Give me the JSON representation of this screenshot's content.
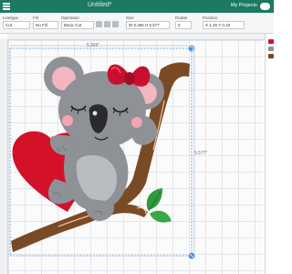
{
  "app": {
    "title": "Untitled*",
    "my_projects": "My Projects"
  },
  "toolbar": {
    "groups": [
      {
        "label": "Linetype",
        "value": "Cut"
      },
      {
        "label": "Fill",
        "value": "No Fill"
      },
      {
        "label": "Operation",
        "value": "Basic Cut"
      },
      {
        "label": "Size",
        "value": "W 5.366  H 5.577"
      },
      {
        "label": "Rotate",
        "value": "0"
      },
      {
        "label": "Position",
        "value": "X 1.45  Y 0.18"
      }
    ]
  },
  "canvas": {
    "width_dimension": "5.366\"",
    "height_dimension": "5.577\""
  },
  "colors": {
    "topbar": "#1c7a64",
    "koala_gray": "#8e9196",
    "heart_red": "#d3122a",
    "bow_red": "#c8102e",
    "branch_brown": "#7a4a24",
    "leaf_green": "#2e9a3c",
    "selection_blue": "#4a90e2"
  },
  "icons": {
    "menu": "hamburger-icon",
    "rotate_handle": "rotate-icon",
    "scale_handle": "resize-icon"
  }
}
